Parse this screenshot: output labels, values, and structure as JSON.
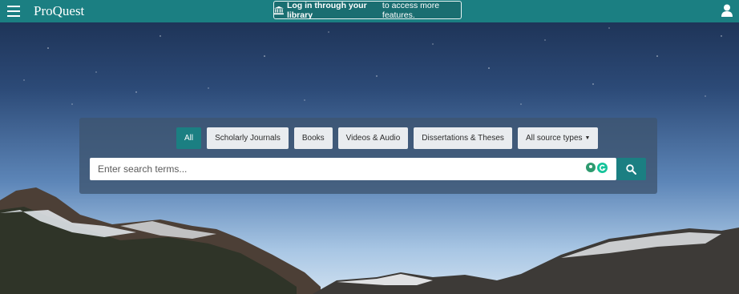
{
  "topbar": {
    "logo": "ProQuest",
    "login_bold": "Log in through your library",
    "login_rest": "to access more features."
  },
  "search": {
    "filters": [
      "All",
      "Scholarly Journals",
      "Books",
      "Videos & Audio",
      "Dissertations & Theses",
      "All source types"
    ],
    "active_filter": "All",
    "placeholder": "Enter search terms..."
  },
  "icons": {
    "menu": "hamburger-icon",
    "library": "institution-icon",
    "user": "user-icon",
    "search": "magnifier-icon",
    "input_addons": [
      "location-pin-icon",
      "grammarly-icon"
    ]
  },
  "colors": {
    "brand": "#1b7f82",
    "chip_bg": "#e9ecef"
  }
}
